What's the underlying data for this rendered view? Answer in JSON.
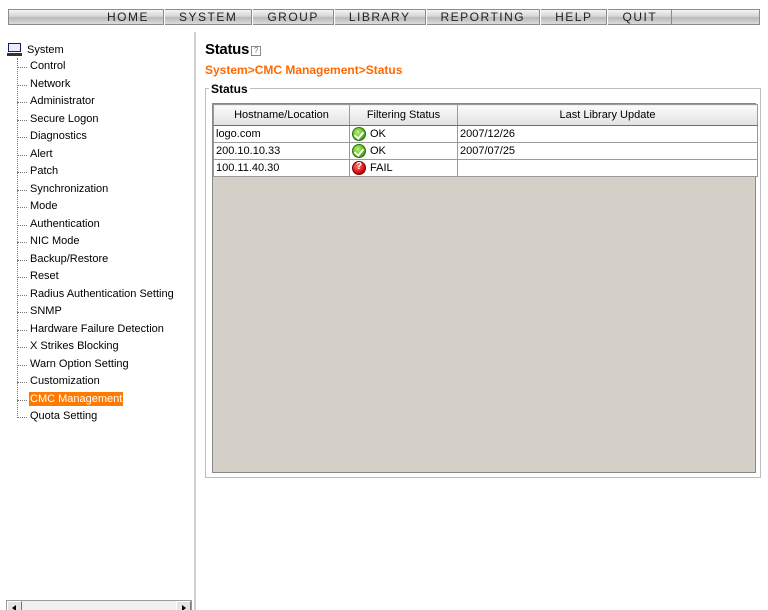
{
  "menu": {
    "items": [
      "HOME",
      "SYSTEM",
      "GROUP",
      "LIBRARY",
      "REPORTING",
      "HELP",
      "QUIT"
    ]
  },
  "sidebar": {
    "root_label": "System",
    "items": [
      {
        "label": "Control",
        "selected": false
      },
      {
        "label": "Network",
        "selected": false
      },
      {
        "label": "Administrator",
        "selected": false
      },
      {
        "label": "Secure Logon",
        "selected": false
      },
      {
        "label": "Diagnostics",
        "selected": false
      },
      {
        "label": "Alert",
        "selected": false
      },
      {
        "label": "Patch",
        "selected": false
      },
      {
        "label": "Synchronization",
        "selected": false
      },
      {
        "label": "Mode",
        "selected": false
      },
      {
        "label": "Authentication",
        "selected": false
      },
      {
        "label": "NIC Mode",
        "selected": false
      },
      {
        "label": "Backup/Restore",
        "selected": false
      },
      {
        "label": "Reset",
        "selected": false
      },
      {
        "label": "Radius Authentication Setting",
        "selected": false
      },
      {
        "label": "SNMP",
        "selected": false
      },
      {
        "label": "Hardware Failure Detection",
        "selected": false
      },
      {
        "label": "X Strikes Blocking",
        "selected": false
      },
      {
        "label": "Warn Option Setting",
        "selected": false
      },
      {
        "label": "Customization",
        "selected": false
      },
      {
        "label": "CMC Management",
        "selected": true
      },
      {
        "label": "Quota Setting",
        "selected": false
      }
    ],
    "selected_color": "#ff7a00"
  },
  "main": {
    "title": "Status",
    "breadcrumb": "System>CMC Management>Status",
    "section_legend": "Status",
    "table": {
      "columns": [
        "Hostname/Location",
        "Filtering Status",
        "Last Library Update"
      ],
      "rows": [
        {
          "host": "logo.com",
          "status": "OK",
          "status_icon": "ok-check-icon",
          "updated": "2007/12/26"
        },
        {
          "host": "200.10.10.33",
          "status": "OK",
          "status_icon": "ok-check-icon",
          "updated": "2007/07/25"
        },
        {
          "host": "100.11.40.30",
          "status": "FAIL",
          "status_icon": "fail-question-icon",
          "updated": ""
        }
      ]
    }
  },
  "colors": {
    "accent": "#ff6a00",
    "ok": "#4aa514",
    "fail": "#cc0000"
  }
}
